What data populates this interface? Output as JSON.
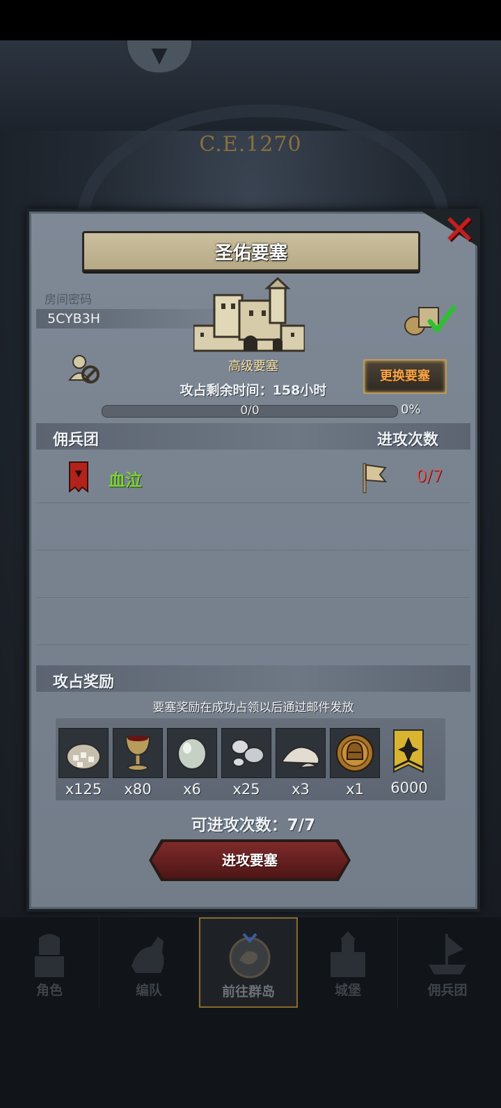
{
  "background": {
    "year_label": "C.E.1270"
  },
  "dialog": {
    "title": "圣佑要塞",
    "room": {
      "label": "房间密码",
      "code": "5CYB3H"
    },
    "fortress_level": "高级要塞",
    "change_button": "更换要塞",
    "attack_time_label": "攻占剩余时间：158小时",
    "progress": {
      "text": "0/0",
      "percent_text": "0%",
      "fraction": 0
    },
    "guild_section": {
      "left_title": "佣兵团",
      "right_title": "进攻次数",
      "rows": [
        {
          "name": "血泣",
          "attacks": "0/7"
        }
      ]
    },
    "rewards_section": {
      "title": "攻占奖励",
      "note": "要塞奖励在成功占领以后通过邮件发放",
      "items": [
        {
          "icon": "flour-sack-icon",
          "qty": "x125"
        },
        {
          "icon": "wine-goblet-icon",
          "qty": "x80"
        },
        {
          "icon": "pearl-stone-icon",
          "qty": "x6"
        },
        {
          "icon": "silver-ore-icon",
          "qty": "x25"
        },
        {
          "icon": "salt-pile-icon",
          "qty": "x3"
        },
        {
          "icon": "knight-medal-icon",
          "qty": "x1"
        },
        {
          "icon": "honor-banner-icon",
          "qty": "6000"
        }
      ]
    },
    "remaining_attacks": "可进攻次数：7/7",
    "attack_button": "进攻要塞"
  },
  "bottom_nav": {
    "items": [
      {
        "label": "角色",
        "icon": "knight-icon"
      },
      {
        "label": "编队",
        "icon": "horse-rider-icon"
      },
      {
        "label": "前往群岛",
        "icon": "dragon-compass-icon",
        "active": true
      },
      {
        "label": "城堡",
        "icon": "castle-icon"
      },
      {
        "label": "佣兵团",
        "icon": "ship-icon"
      }
    ]
  },
  "colors": {
    "guild_name": "#7dd13b",
    "attack_count": "#d85a5a",
    "change_button_text": "#f4a548",
    "close": "#c21f1f"
  }
}
